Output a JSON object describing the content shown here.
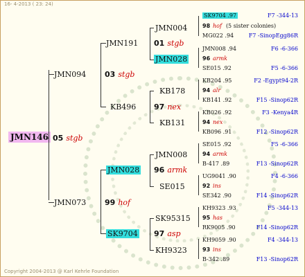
{
  "date": "16-  4-2013 ( 23: 24)",
  "copyright": "Copyright 2004-2013 @ Karl Kehrle Foundation",
  "root": {
    "id": "JMN146",
    "num": "05",
    "hname": "stgb"
  },
  "gen1": {
    "sire": {
      "id": "JMN094",
      "num": "03",
      "hname": "stgb"
    },
    "dam": {
      "id": "JMN073",
      "num": "99",
      "hname": "hof"
    }
  },
  "gen2": {
    "ss": {
      "id": "JMN191",
      "num": "01",
      "hname": "stgb"
    },
    "sd": {
      "id": "KB496",
      "num": "97",
      "hname": "nex"
    },
    "ds": {
      "id": "JMN028",
      "num": "96",
      "hname": "armk"
    },
    "dd": {
      "id": "SK9704",
      "num": "97",
      "hname": "asp"
    }
  },
  "gen3": {
    "a": "JMN004",
    "b": "JMN028",
    "c": "KB178",
    "d": "KB131",
    "e": "JMN008",
    "f": "SE015",
    "g": "SK95315",
    "h": "KH9323"
  },
  "gen4": [
    {
      "top": {
        "id": "SK9704 .97",
        "origin": "F7 -344-13"
      },
      "num": "98",
      "hname": "hof",
      "note": "(5 sister colonies)",
      "bot": {
        "id": "MG022 .94",
        "origin": "F7 -SinopEgg86R"
      }
    },
    {
      "top": {
        "id": "JMN008 .94",
        "origin": "F6 -6-366"
      },
      "num": "96",
      "hname": "armk",
      "note": "",
      "bot": {
        "id": "SE015 .92",
        "origin": "F5 -6-366"
      }
    },
    {
      "top": {
        "id": "KB204 .95",
        "origin": "F2 -Egypt94-2R"
      },
      "num": "94",
      "hname": "alr",
      "note": "",
      "bot": {
        "id": "KB141 .92",
        "origin": "F15 -Sinop62R"
      }
    },
    {
      "top": {
        "id": "KB026 .92",
        "origin": "F3 -Kenya4R"
      },
      "num": "94",
      "hname": "nex",
      "note": "",
      "bot": {
        "id": "KB096 .91",
        "origin": "F12 -Sinop62R"
      }
    },
    {
      "top": {
        "id": "SE015 .92",
        "origin": "F5 -6-366"
      },
      "num": "94",
      "hname": "armk",
      "note": "",
      "bot": {
        "id": "B-417 .89",
        "origin": "F13 -Sinop62R"
      }
    },
    {
      "top": {
        "id": "UG9041 .90",
        "origin": "F4 -6-366"
      },
      "num": "92",
      "hname": "ins",
      "note": "",
      "bot": {
        "id": "SE342 .90",
        "origin": "F14 -Sinop62R"
      }
    },
    {
      "top": {
        "id": "KH9323 .93",
        "origin": "F5 -344-13"
      },
      "num": "95",
      "hname": "has",
      "note": "",
      "bot": {
        "id": "RK9005 .90",
        "origin": "F14 -Sinop62R"
      }
    },
    {
      "top": {
        "id": "KH9059 .90",
        "origin": "F4 -344-13"
      },
      "num": "93",
      "hname": "ins",
      "note": "",
      "bot": {
        "id": "B-342 .89",
        "origin": "F13 -Sinop62R"
      }
    }
  ]
}
